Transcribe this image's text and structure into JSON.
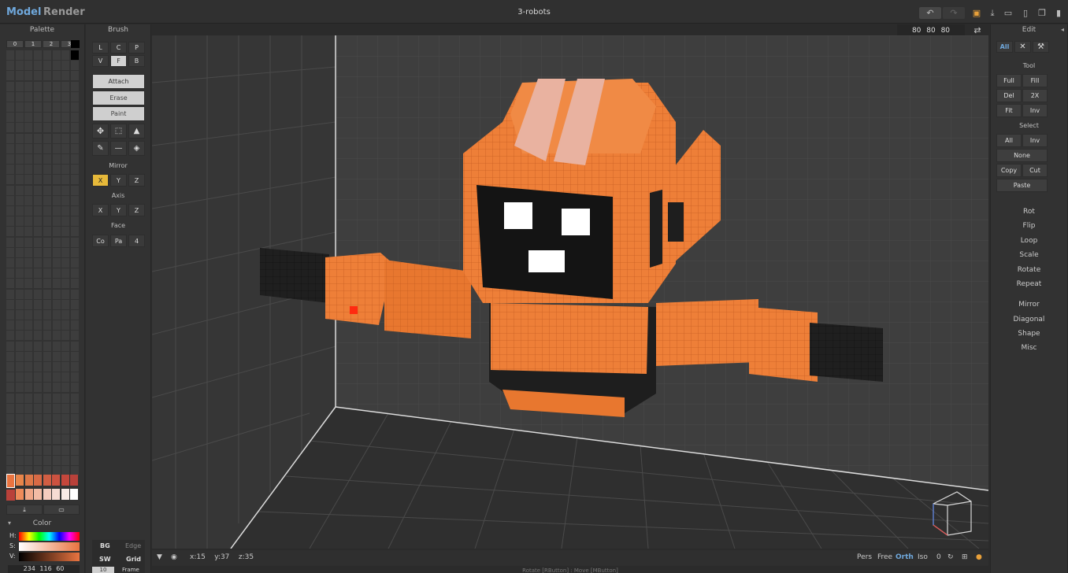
{
  "app": {
    "tabs": [
      {
        "label": "Model",
        "active": true
      },
      {
        "label": "Render",
        "active": false
      }
    ],
    "document_title": "3-robots",
    "accent_color": "#6fa8dc"
  },
  "toolbar_icons": [
    "undo-icon",
    "redo-icon",
    "save-icon",
    "export-icon",
    "open-folder-icon",
    "new-file-icon",
    "copy-file-icon",
    "delete-file-icon"
  ],
  "palette": {
    "title": "Palette",
    "pages": [
      "0",
      "1",
      "2",
      "3"
    ],
    "swatch_colors": [
      "#e8854a",
      "#de7848",
      "#d86a45",
      "#d25e43",
      "#cc5240",
      "#c4473c",
      "#b9413a",
      "#ee8b5a",
      "#f0a888",
      "#f2bca5",
      "#f4cdbf",
      "#f6dcd3",
      "#f9ebe6",
      "#ffffff"
    ],
    "selected_color": "#ea7440",
    "color_label": "Color",
    "hsv_labels": [
      "H:",
      "S:",
      "V:"
    ],
    "rgb_readout": "234 116 60"
  },
  "brush": {
    "title": "Brush",
    "shapes_row1": [
      "L",
      "C",
      "P"
    ],
    "shapes_row2": [
      "V",
      "F",
      "B"
    ],
    "modes": [
      "Attach",
      "Erase",
      "Paint"
    ],
    "tool_icons": [
      "move-icon",
      "select-box-icon",
      "text-cursor-icon",
      "eyedropper-icon",
      "line-icon",
      "bucket-icon"
    ],
    "mirror_label": "Mirror",
    "mirror": [
      "X",
      "Y",
      "Z"
    ],
    "axis_label": "Axis",
    "axis": [
      "X",
      "Y",
      "Z"
    ],
    "face_label": "Face",
    "face": [
      "Co",
      "Pa",
      "4"
    ],
    "display_toggles": [
      "BG",
      "Edge",
      "SW",
      "Grid"
    ],
    "frame_value": "10",
    "frame_label": "Frame"
  },
  "viewport": {
    "size": "80 80 80",
    "coordinates": "x:15    y:37    z:35",
    "view_modes": [
      "Pers",
      "Free",
      "Orth",
      "Iso"
    ],
    "active_view": "Orth",
    "zoom_value": "0",
    "robot_color": "#ee7f38",
    "status_hint": "Rotate [RButton] : Move [MButton]"
  },
  "edit": {
    "title": "Edit",
    "filters": [
      "All"
    ],
    "tool_label": "Tool",
    "tools": [
      "Full",
      "Fill",
      "Del",
      "2X",
      "Fit",
      "Inv"
    ],
    "select_label": "Select",
    "select": [
      "All",
      "Inv",
      "None",
      "Copy",
      "Cut",
      "Paste"
    ],
    "menu1": [
      "Rot",
      "Flip",
      "Loop",
      "Scale",
      "Rotate",
      "Repeat"
    ],
    "menu2": [
      "Mirror",
      "Diagonal",
      "Shape",
      "Misc"
    ]
  }
}
